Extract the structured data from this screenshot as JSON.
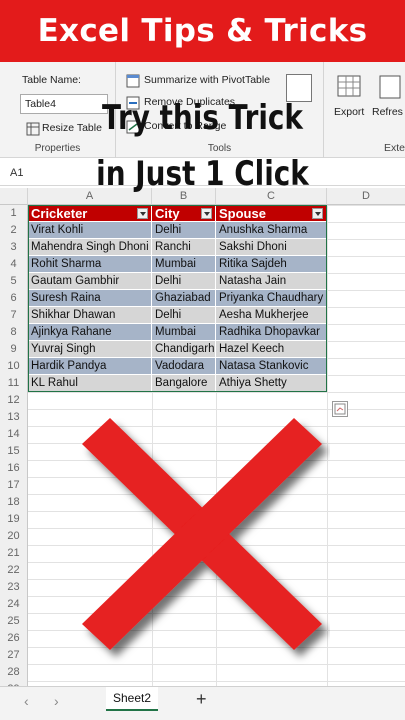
{
  "banner": {
    "title": "Excel Tips & Tricks"
  },
  "overlay": {
    "line1": "Try this Trick",
    "line2": "in Just 1 Click"
  },
  "ribbon": {
    "table_name_label": "Table Name:",
    "table_name_value": "Table4",
    "resize_table": "Resize Table",
    "properties_label": "Properties",
    "summarize_pivot": "Summarize with PivotTable",
    "remove_duplicates": "Remove Duplicates",
    "convert_to_range": "Convert to Range",
    "tools_label": "Tools",
    "export_label": "Export",
    "refresh_label": "Refres",
    "external_label": "Exte"
  },
  "formula_bar": {
    "name_box": "A1"
  },
  "columns": [
    "A",
    "B",
    "C",
    "D"
  ],
  "rows": [
    "1",
    "2",
    "3",
    "4",
    "5",
    "6",
    "7",
    "8",
    "9",
    "10",
    "11",
    "12",
    "13",
    "14",
    "15",
    "16",
    "17",
    "18",
    "19",
    "20",
    "21",
    "22",
    "23",
    "24",
    "25",
    "26",
    "27",
    "28",
    "29"
  ],
  "table": {
    "headers": [
      "Cricketer",
      "City",
      "Spouse"
    ],
    "data": [
      [
        "Virat Kohli",
        "Delhi",
        "Anushka Sharma"
      ],
      [
        "Mahendra Singh Dhoni",
        "Ranchi",
        "Sakshi Dhoni"
      ],
      [
        "Rohit Sharma",
        "Mumbai",
        "Ritika Sajdeh"
      ],
      [
        "Gautam Gambhir",
        "Delhi",
        "Natasha Jain"
      ],
      [
        "Suresh Raina",
        "Ghaziabad",
        "Priyanka Chaudhary"
      ],
      [
        "Shikhar Dhawan",
        "Delhi",
        "Aesha Mukherjee"
      ],
      [
        "Ajinkya Rahane",
        "Mumbai",
        "Radhika Dhopavkar"
      ],
      [
        "Yuvraj Singh",
        "Chandigarh",
        "Hazel Keech"
      ],
      [
        "Hardik Pandya",
        "Vadodara",
        "Natasa Stankovic"
      ],
      [
        "KL Rahul",
        "Bangalore",
        "Athiya Shetty"
      ]
    ]
  },
  "sheet_tabs": {
    "active": "Sheet2",
    "add": "+",
    "prev": "‹",
    "next": "›"
  },
  "colors": {
    "banner": "#e31b1b",
    "header_fill": "#c00000",
    "band_dark": "#a6b4c8",
    "band_light": "#d6d6d6",
    "x_mark": "#e62020"
  }
}
